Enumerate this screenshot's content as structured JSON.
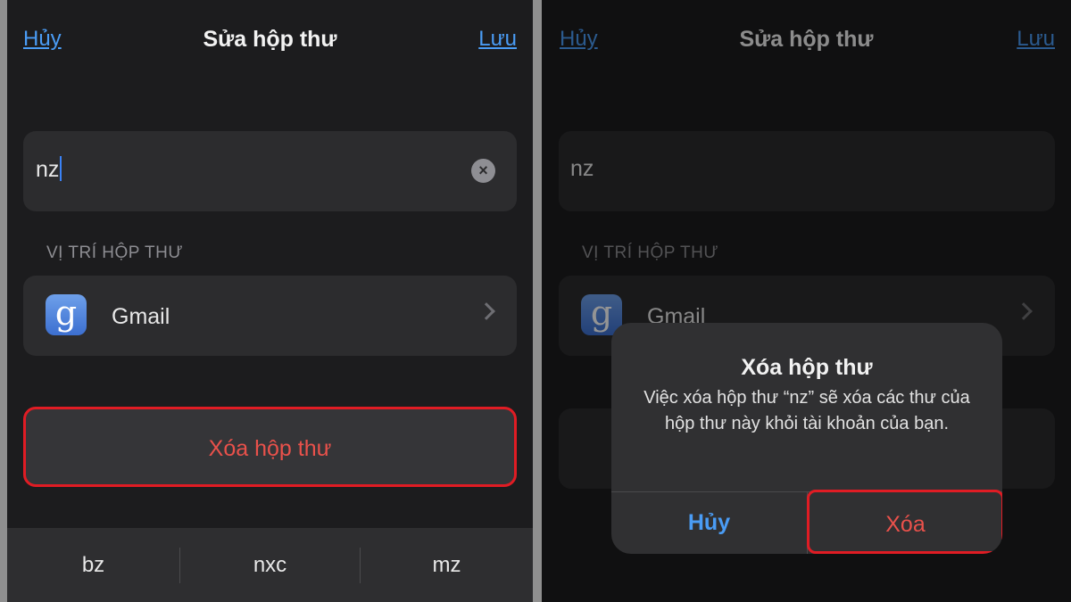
{
  "nav": {
    "cancel_label": "Hủy",
    "title": "Sửa hộp thư",
    "save_label": "Lưu"
  },
  "mailbox": {
    "name_value": "nz",
    "location_section_label": "VỊ TRÍ HỘP THƯ",
    "location_icon_glyph": "g",
    "location_label": "Gmail",
    "delete_button_label": "Xóa hộp thư"
  },
  "keyboard": {
    "suggestions": [
      "bz",
      "nxc",
      "mz"
    ]
  },
  "alert": {
    "title": "Xóa hộp thư",
    "message": "Việc xóa hộp thư “nz” sẽ xóa các thư của hộp thư này khỏi tài khoản của bạn.",
    "cancel_label": "Hủy",
    "confirm_label": "Xóa"
  },
  "colors": {
    "background": "#1c1c1e",
    "cell": "#2c2c2e",
    "link_blue": "#4a9cf5",
    "destructive_red": "#e9514b",
    "highlight_border": "#e01c24"
  }
}
